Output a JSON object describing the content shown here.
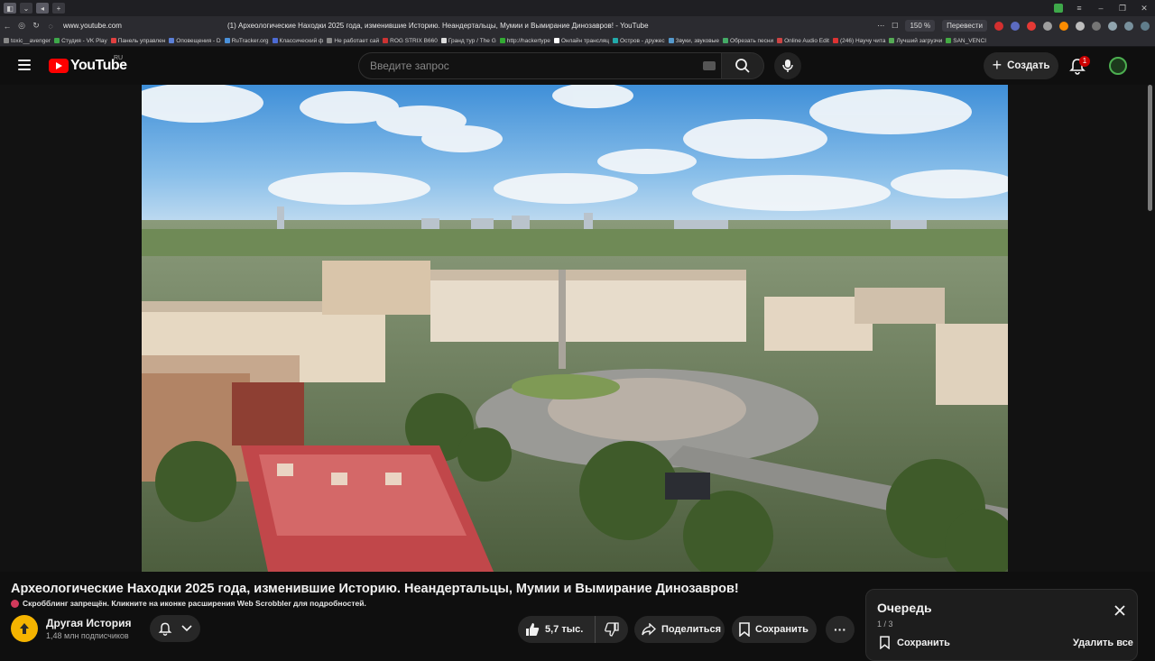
{
  "browser": {
    "url": "www.youtube.com",
    "tab_title": "(1) Археологические Находки 2025 года, изменившие Историю. Неандертальцы, Мумии и Вымирание Динозавров! - YouTube",
    "zoom": "150 %",
    "translate_label": "Перевести",
    "bookmarks": [
      "toxic__avenger",
      "Студия - VK Play",
      "Панель управлен",
      "Оповещения - D",
      "RuTracker.org",
      "Классический ф",
      "Не работает сай",
      "ROG STRIX B660",
      "Гранд тур / The G",
      "http://hackertype",
      "Онлайн трансляц",
      "Остров - дружес",
      "Звуки, звуковые",
      "Обрезать песни",
      "Online Audio Edit",
      "(246) Научу чита",
      "Лучший загрузчи",
      "SAN_VENCI"
    ]
  },
  "header": {
    "logo_text": "YouTube",
    "region": "RU",
    "search_placeholder": "Введите запрос",
    "create_label": "Создать",
    "notifications_count": "1"
  },
  "video": {
    "title": "Археологические Находки 2025 года, изменившие Историю. Неандертальцы, Мумии и Вымирание Динозавров!",
    "scrobble_notice": "Скробблинг запрещён. Кликните на иконке расширения Web Scrobbler для подробностей.",
    "channel_name": "Другая История",
    "subscribers": "1,48 млн подписчиков",
    "likes": "5,7 тыс.",
    "share_label": "Поделиться",
    "save_label": "Сохранить"
  },
  "queue": {
    "title": "Очередь",
    "count": "1 / 3",
    "save_label": "Сохранить",
    "clear_label": "Удалить все"
  },
  "colors": {
    "background": "#0f0f0f",
    "brand_red": "#ff0000",
    "button_bg": "#272727",
    "channel_avatar": "#f5b400"
  }
}
